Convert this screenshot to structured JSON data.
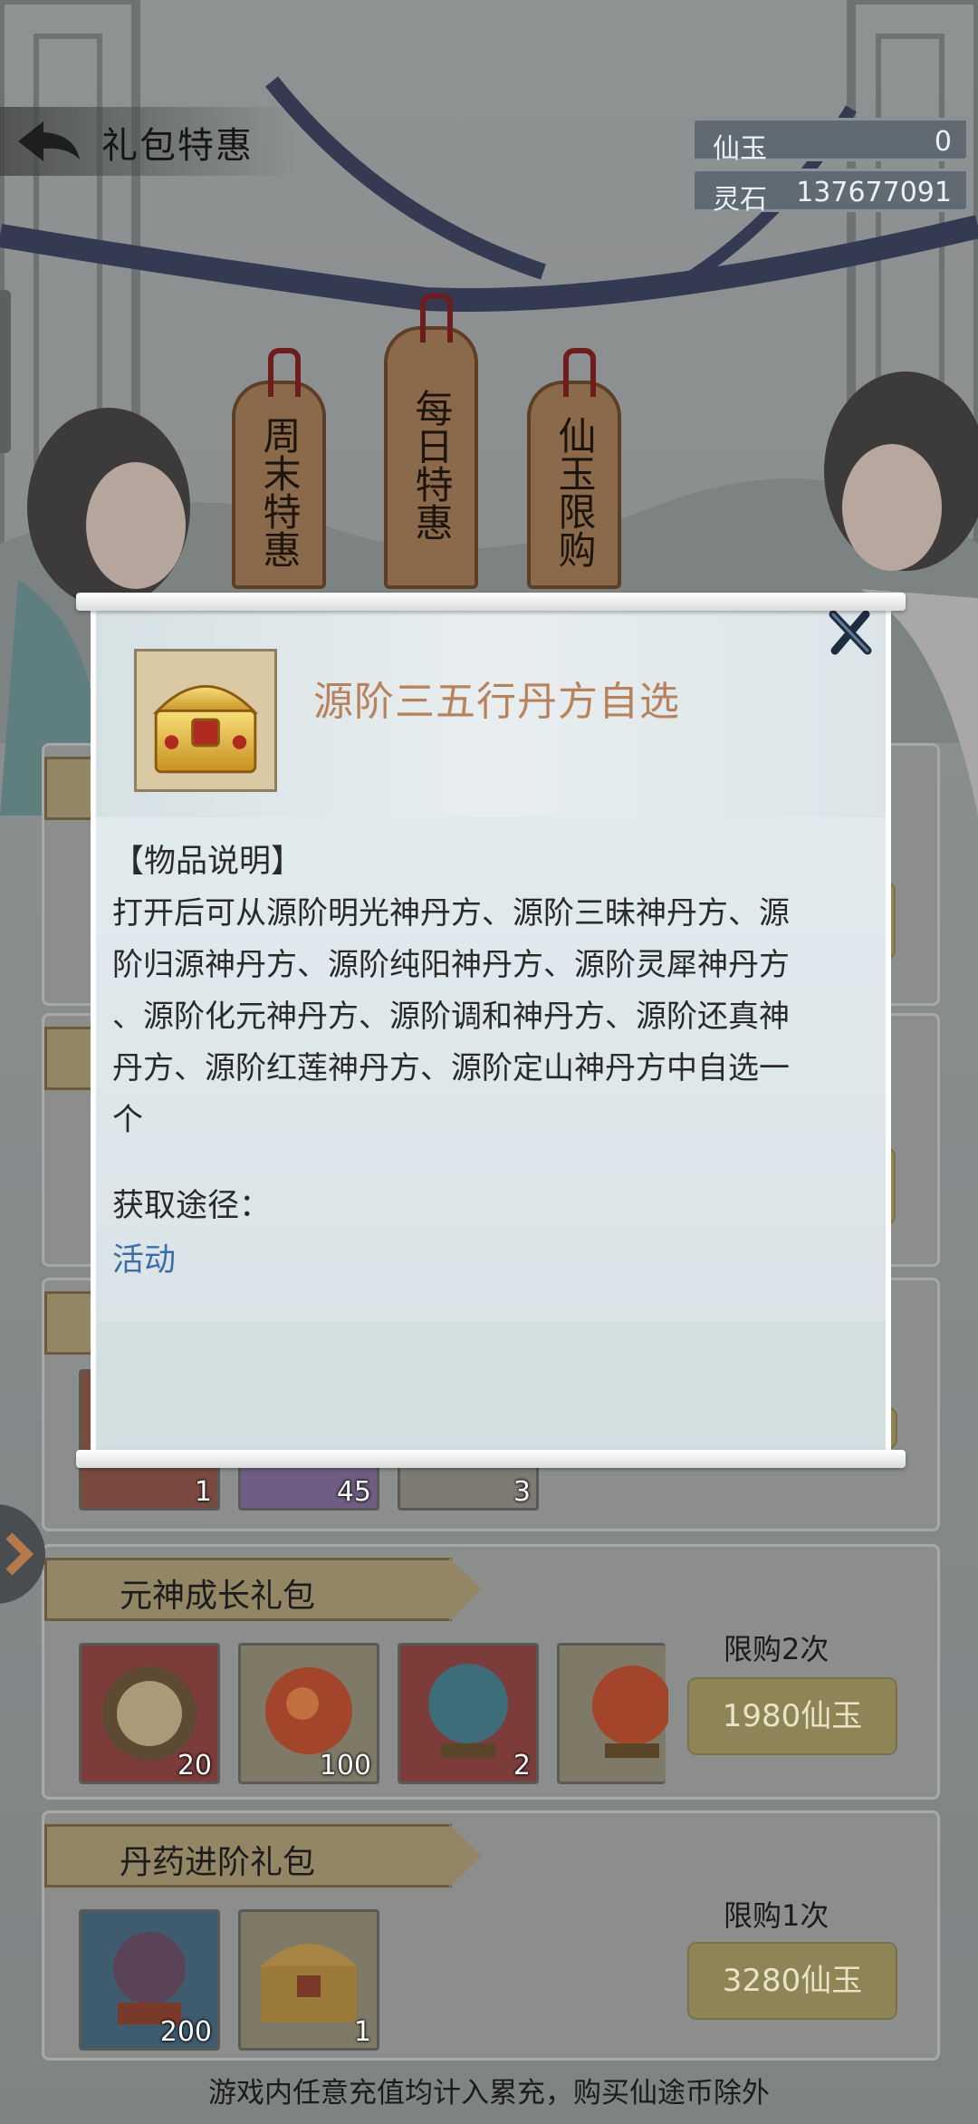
{
  "header": {
    "title": "礼包特惠"
  },
  "currency": [
    {
      "name": "仙玉",
      "value": "0"
    },
    {
      "name": "灵石",
      "value": "137677091"
    }
  ],
  "tags": [
    {
      "label": "周末特惠"
    },
    {
      "label": "每日特惠"
    },
    {
      "label": "仙玉限购"
    }
  ],
  "packs": [
    {
      "title": "",
      "items": [
        {
          "icon": "dragon-icon",
          "count": "1"
        },
        {
          "icon": "scroll-icon",
          "count": "45"
        },
        {
          "icon": "crystal-icon",
          "count": "3"
        }
      ]
    },
    {
      "title": "元神成长礼包",
      "limit": "限购2次",
      "price": "1980仙玉",
      "items": [
        {
          "icon": "bronze-mirror-icon",
          "count": "20"
        },
        {
          "icon": "fire-orb-icon",
          "count": "100"
        },
        {
          "icon": "blue-orb-icon",
          "count": "2"
        },
        {
          "icon": "red-orb-icon",
          "count": ""
        }
      ]
    },
    {
      "title": "丹药进阶礼包",
      "limit": "限购1次",
      "price": "3280仙玉",
      "items": [
        {
          "icon": "purple-orb-icon",
          "count": "200"
        },
        {
          "icon": "treasure-chest-icon",
          "count": "1"
        }
      ]
    }
  ],
  "footer_note": "游戏内任意充值均计入累充，购买仙途币除外",
  "dialog": {
    "item_name": "源阶三五行丹方自选",
    "item_icon": "treasure-chest-icon",
    "desc_header": "【物品说明】",
    "desc_lines": [
      "打开后可从源阶明光神丹方、源阶三昧神丹方、源",
      "阶归源神丹方、源阶纯阳神丹方、源阶灵犀神丹方",
      "、源阶化元神丹方、源阶调和神丹方、源阶还真神",
      "丹方、源阶红莲神丹方、源阶定山神丹方中自选一",
      "个"
    ],
    "source_header": "获取途径：",
    "source_link": "活动"
  },
  "colors": {
    "item_name": "#b8825b",
    "link": "#3b6ea8",
    "button": "#8e8557"
  }
}
